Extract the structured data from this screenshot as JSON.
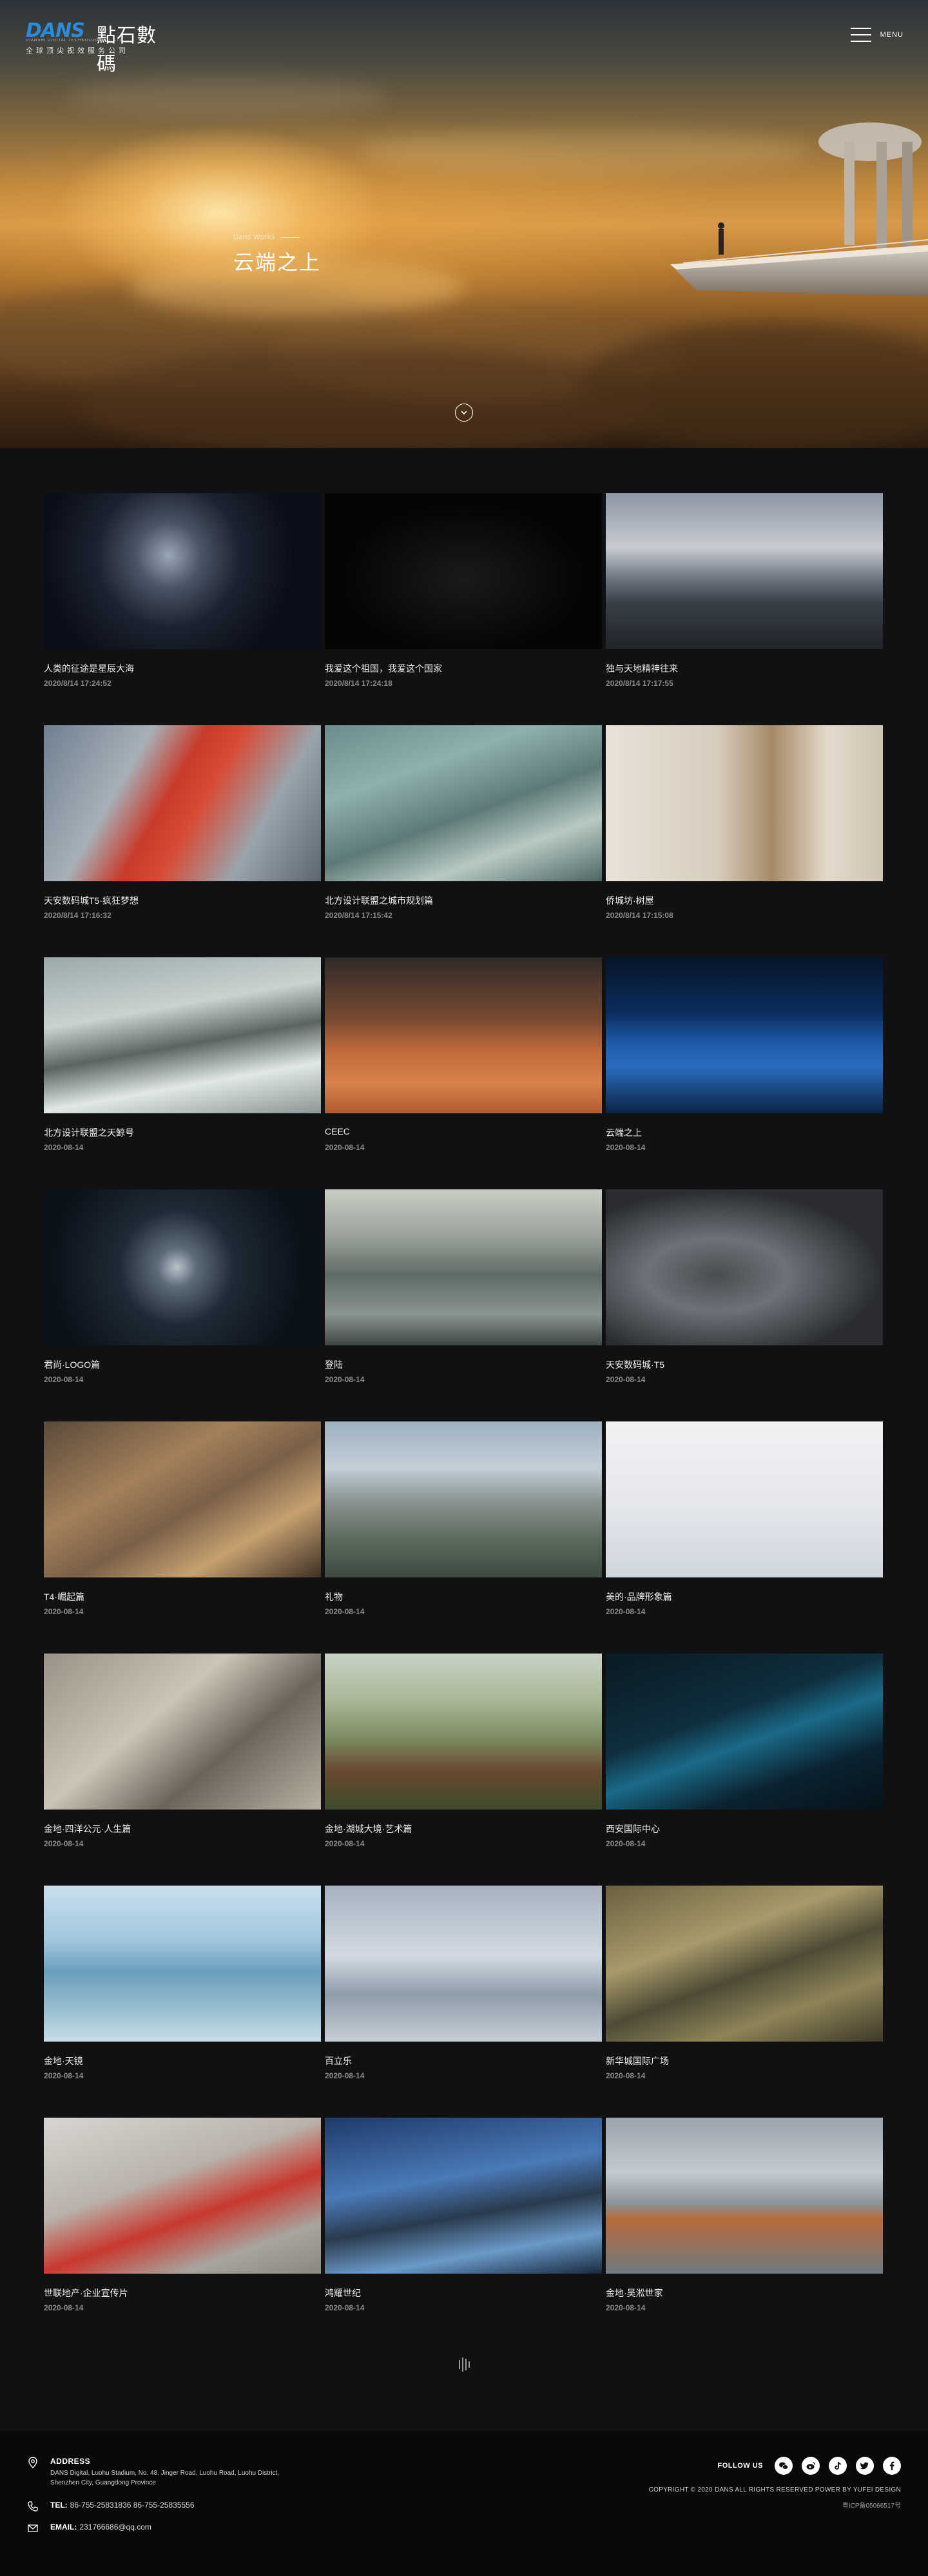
{
  "header": {
    "logo_mark": "DANS",
    "logo_cn": "點石數碼",
    "logo_en": "DIANSHI DIGITAL TECHNOLOGY CO.,LTD",
    "logo_sub": "全球顶尖视效服务公司",
    "menu_label": "MENU"
  },
  "hero": {
    "eyebrow": "Dans Works",
    "title": "云端之上"
  },
  "works": [
    {
      "title": "人类的征途是星辰大海",
      "date": "2020/8/14 17:24:52"
    },
    {
      "title": "我爱这个祖国，我爱这个国家",
      "date": "2020/8/14 17:24:18"
    },
    {
      "title": "独与天地精神往来",
      "date": "2020/8/14 17:17:55"
    },
    {
      "title": "天安数码城T5·疯狂梦想",
      "date": "2020/8/14 17:16:32"
    },
    {
      "title": "北方设计联盟之城市规划篇",
      "date": "2020/8/14 17:15:42"
    },
    {
      "title": "侨城坊·树屋",
      "date": "2020/8/14 17:15:08"
    },
    {
      "title": "北方设计联盟之天鲸号",
      "date": "2020-08-14"
    },
    {
      "title": "CEEC",
      "date": "2020-08-14"
    },
    {
      "title": "云端之上",
      "date": "2020-08-14"
    },
    {
      "title": "君尚·LOGO篇",
      "date": "2020-08-14"
    },
    {
      "title": "登陆",
      "date": "2020-08-14"
    },
    {
      "title": "天安数码城·T5",
      "date": "2020-08-14"
    },
    {
      "title": "T4·崛起篇",
      "date": "2020-08-14"
    },
    {
      "title": "礼物",
      "date": "2020-08-14"
    },
    {
      "title": "美的·品牌形象篇",
      "date": "2020-08-14"
    },
    {
      "title": "金地·四洋公元·人生篇",
      "date": "2020-08-14"
    },
    {
      "title": "金地·湖城大境·艺术篇",
      "date": "2020-08-14"
    },
    {
      "title": "西安国际中心",
      "date": "2020-08-14"
    },
    {
      "title": "金地·天镜",
      "date": "2020-08-14"
    },
    {
      "title": "百立乐",
      "date": "2020-08-14"
    },
    {
      "title": "新华城国际广场",
      "date": "2020-08-14"
    },
    {
      "title": "世联地产·企业宣传片",
      "date": "2020-08-14"
    },
    {
      "title": "鸿耀世纪",
      "date": "2020-08-14"
    },
    {
      "title": "金地·吴淞世家",
      "date": "2020-08-14"
    }
  ],
  "footer": {
    "address_label": "ADDRESS",
    "address_line1": "DANS Digital, Luohu Stadium, No. 48, Jinger Road, Luohu Road, Luohu District,",
    "address_line2": "Shenzhen City, Guangdong Province",
    "tel_label": "TEL:",
    "tel_value": "86-755-25831836  86-755-25835556",
    "email_label": "EMAIL:",
    "email_value": "231766686@qq.com",
    "follow_label": "FOLLOW US",
    "copyright": "COPYRIGHT © 2020 DANS ALL RIGHTS RESERVED POWER BY YUFEI DESIGN",
    "icp": "粤ICP备05066517号"
  }
}
